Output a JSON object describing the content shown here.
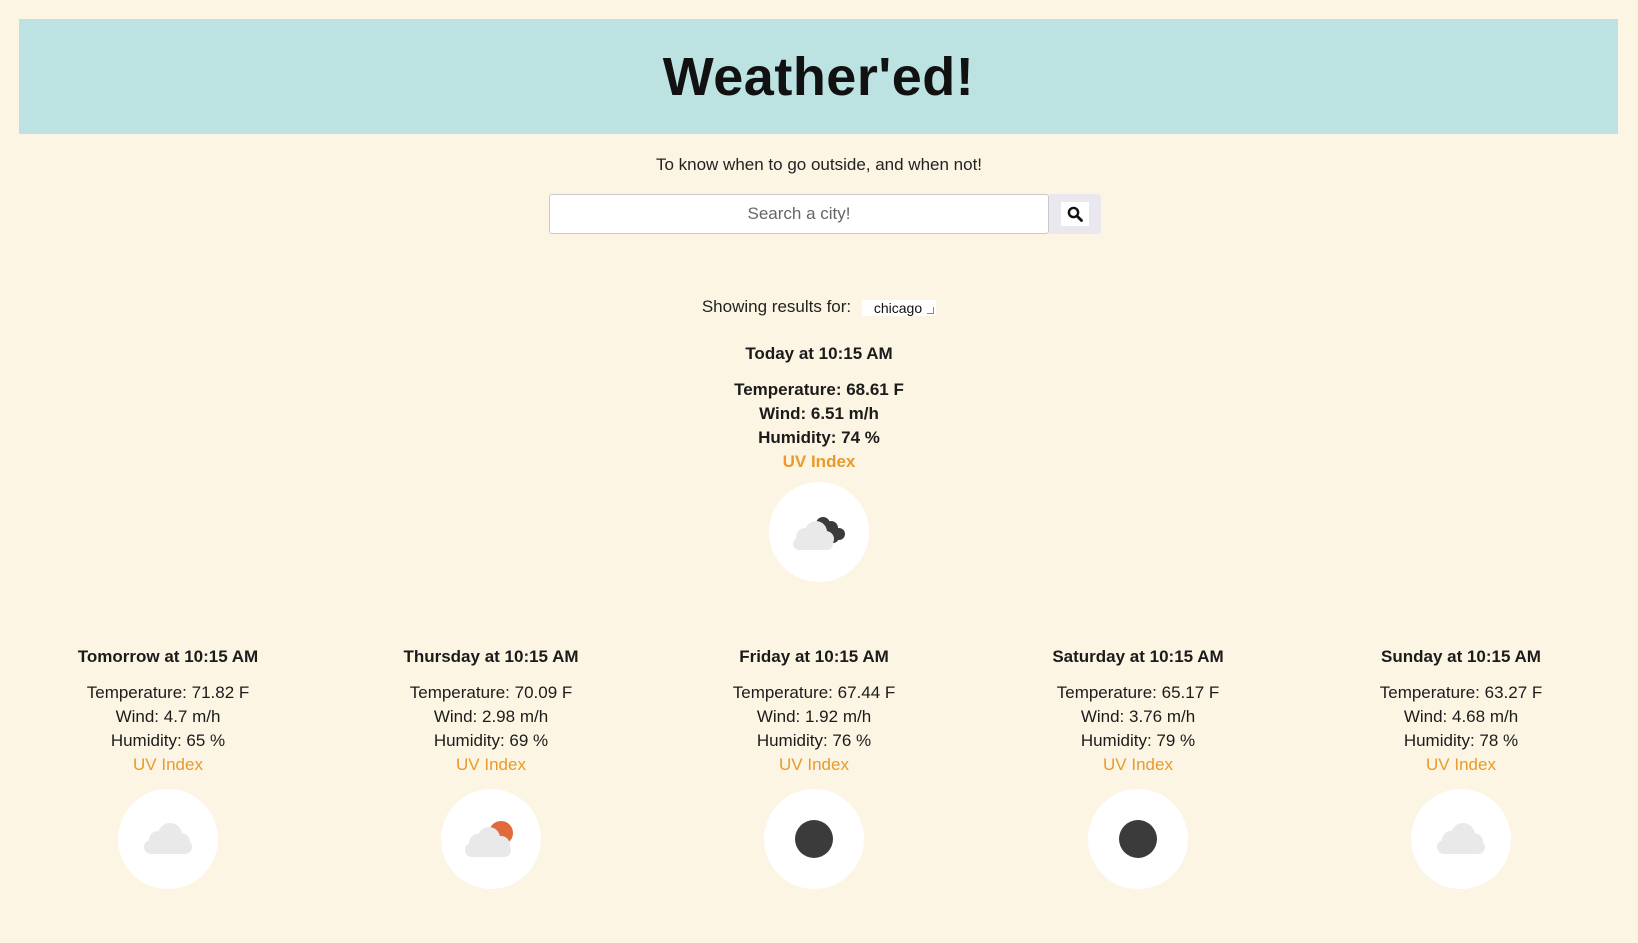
{
  "header": {
    "title": "Weather'ed!"
  },
  "tagline": "To know when to go outside, and when not!",
  "search": {
    "placeholder": "Search a city!",
    "value": ""
  },
  "results": {
    "label": "Showing results for:",
    "city": "chicago"
  },
  "today": {
    "title": "Today at 10:15 AM",
    "temperature": "Temperature: 68.61 F",
    "wind": "Wind: 6.51 m/h",
    "humidity": "Humidity: 74 %",
    "uv": "UV Index",
    "icon": "cloud-moon-icon"
  },
  "forecast": [
    {
      "title": "Tomorrow at 10:15 AM",
      "temperature": "Temperature: 71.82 F",
      "wind": "Wind: 4.7 m/h",
      "humidity": "Humidity: 65 %",
      "uv": "UV Index",
      "icon": "cloud-icon"
    },
    {
      "title": "Thursday at 10:15 AM",
      "temperature": "Temperature: 70.09 F",
      "wind": "Wind: 2.98 m/h",
      "humidity": "Humidity: 69 %",
      "uv": "UV Index",
      "icon": "cloud-sun-icon"
    },
    {
      "title": "Friday at 10:15 AM",
      "temperature": "Temperature: 67.44 F",
      "wind": "Wind: 1.92 m/h",
      "humidity": "Humidity: 76 %",
      "uv": "UV Index",
      "icon": "moon-icon"
    },
    {
      "title": "Saturday at 10:15 AM",
      "temperature": "Temperature: 65.17 F",
      "wind": "Wind: 3.76 m/h",
      "humidity": "Humidity: 79 %",
      "uv": "UV Index",
      "icon": "moon-icon"
    },
    {
      "title": "Sunday at 10:15 AM",
      "temperature": "Temperature: 63.27 F",
      "wind": "Wind: 4.68 m/h",
      "humidity": "Humidity: 78 %",
      "uv": "UV Index",
      "icon": "cloud-icon"
    }
  ],
  "colors": {
    "background": "#fcf5e3",
    "header": "#bde2e2",
    "uv_link": "#e99a2a",
    "sun": "#e06a3c",
    "moon": "#3b3b3b",
    "cloud": "#e9e9e9"
  }
}
